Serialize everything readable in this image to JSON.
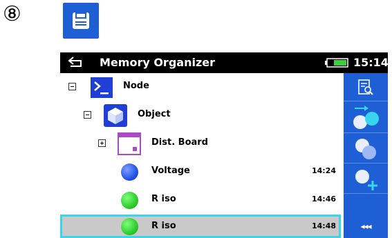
{
  "step_marker": "⑧",
  "titlebar": {
    "title": "Memory Organizer",
    "time": "15:14"
  },
  "tree": [
    {
      "label": "Node",
      "icon": "node-icon",
      "expander": "collapse"
    },
    {
      "label": "Object",
      "icon": "object-cube-icon",
      "expander": "collapse"
    },
    {
      "label": "Dist. Board",
      "icon": "distribution-board-icon",
      "expander": "expand"
    },
    {
      "label": "Voltage",
      "icon": "blue-result-dot-icon",
      "time": "14:24"
    },
    {
      "label": "R iso",
      "icon": "green-result-dot-icon",
      "time": "14:46"
    },
    {
      "label": "R iso",
      "icon": "green-result-dot-icon",
      "time": "14:48",
      "selected": true
    }
  ],
  "sidebar": [
    "view-results-icon",
    "move-test-icon",
    "clone-icon",
    "add-test-icon",
    "more-chevrons-icon"
  ],
  "sidebar_more_label": "◂◂◂",
  "colors": {
    "accent": "#1f5fd6",
    "selection_border": "#38d6ee",
    "selected_row": "#c9c9c9",
    "green": "#2ecc2e",
    "blue": "#2255e6"
  }
}
